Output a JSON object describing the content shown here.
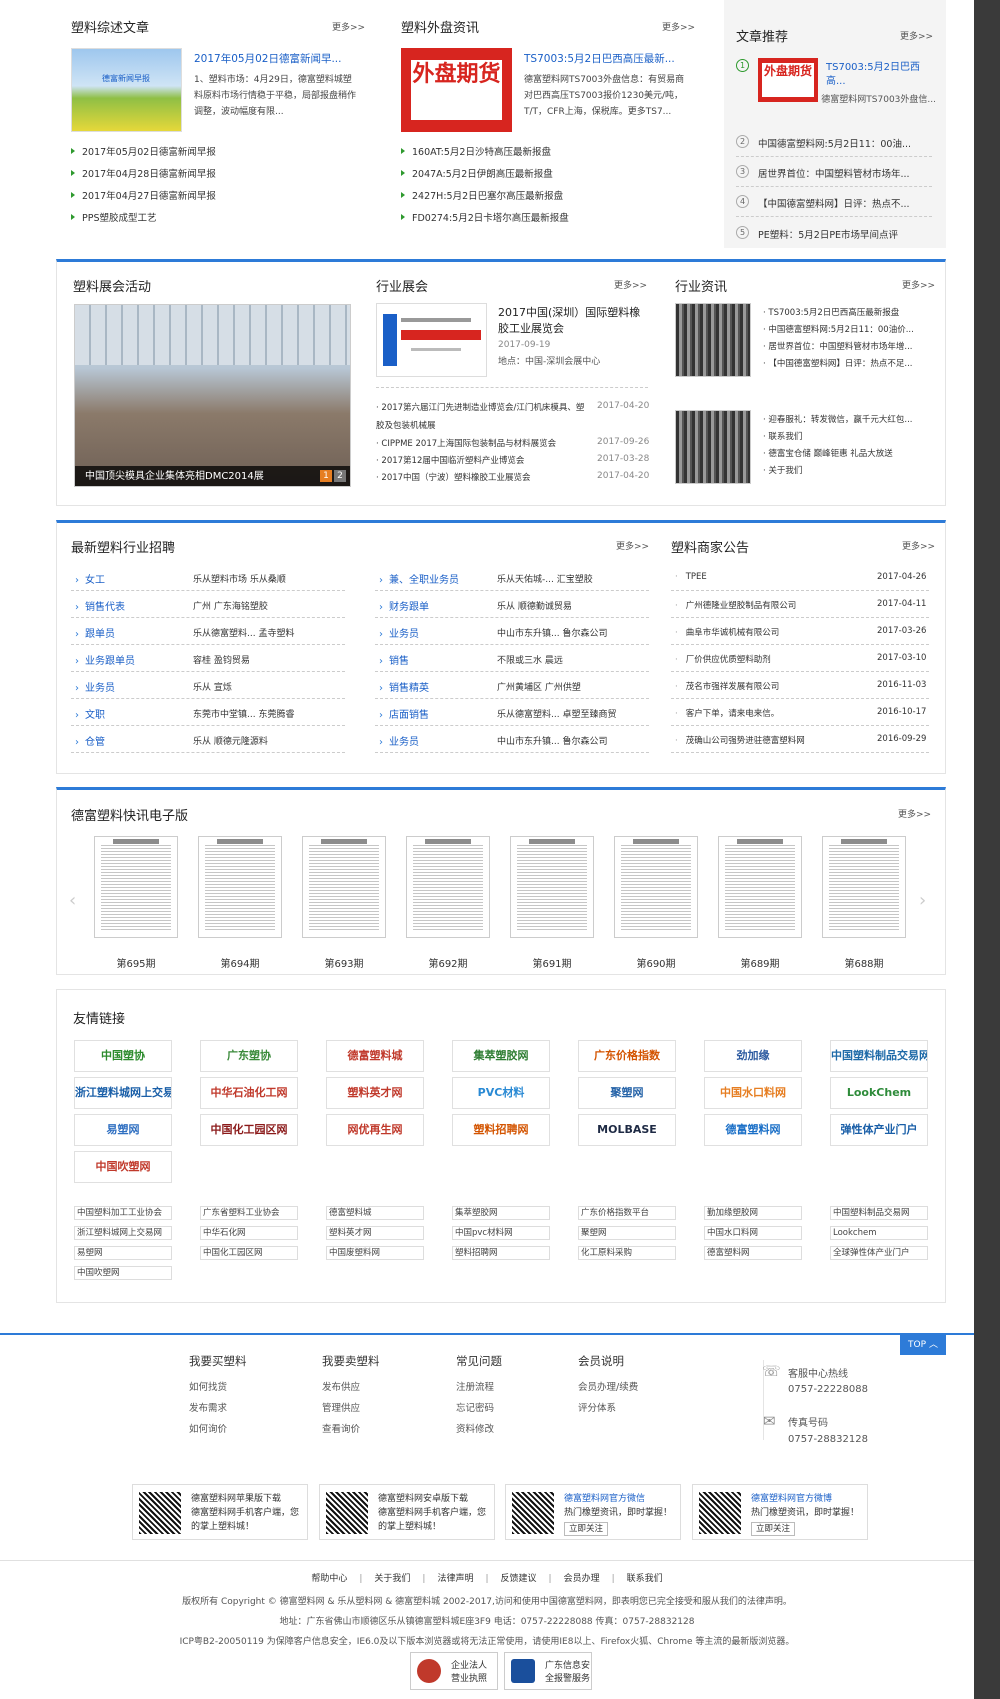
{
  "s1": {
    "left": {
      "title": "塑料综述文章",
      "more": "更多>>",
      "headline": "2017年05月02日德富新闻早...",
      "summary": "1、塑料市场：4月29日，德富塑料城塑料原料市场行情稳于平稳，局部报盘稍作调整，波动幅度有限...",
      "img_text": "德富新闻早报",
      "list": [
        "2017年05月02日德富新闻早报",
        "2017年04月28日德富新闻早报",
        "2017年04月27日德富新闻早报",
        "PPS塑胶成型工艺"
      ]
    },
    "mid": {
      "title": "塑料外盘资讯",
      "more": "更多>>",
      "headline": "TS7003:5月2日巴西高压最新...",
      "summary": "德富塑料网TS7003外盘信息：有贸易商对巴西高压TS7003报价1230美元/吨，T/T，CFR上海，保税库。更多TS7...",
      "img_text": "外盘期货",
      "list": [
        "160AT:5月2日沙特高压最新报盘",
        "2047A:5月2日伊朗高压最新报盘",
        "2427H:5月2日巴塞尔高压最新报盘",
        "FD0274:5月2日卡塔尔高压最新报盘"
      ]
    },
    "right": {
      "title": "文章推荐",
      "more": "更多>>",
      "top_link": "TS7003:5月2日巴西高...",
      "top_sub": "德富塑料网TS7003外盘信...",
      "img_text": "外盘期货",
      "items": [
        "中国德富塑料网:5月2日11：00油...",
        "居世界首位：中国塑料管材市场年...",
        "【中国德富塑料网】日评：热点不...",
        "PE塑料：5月2日PE市场早间点评"
      ],
      "nums": [
        "1",
        "2",
        "3",
        "4",
        "5"
      ]
    }
  },
  "s2": {
    "expo": {
      "title": "塑料展会活动",
      "caption": "中国顶尖模具企业集体亮相DMC2014展",
      "pages": [
        "1",
        "2"
      ]
    },
    "fair": {
      "title": "行业展会",
      "more": "更多>>",
      "feat_title": "2017中国(深圳）国际塑料橡胶工业展览会",
      "feat_date": "2017-09-19",
      "feat_loc": "地点：中国-深圳会展中心",
      "list": [
        {
          "t": "2017第六届江门先进制造业博览会/江门机床模具、塑胶及包装机械展",
          "d": "2017-04-20"
        },
        {
          "t": "CIPPME 2017上海国际包装制品与材料展览会",
          "d": "2017-09-26"
        },
        {
          "t": "2017第12届中国临沂塑料产业博览会",
          "d": "2017-03-28"
        },
        {
          "t": "2017中国（宁波）塑料橡胶工业展览会",
          "d": "2017-04-20"
        }
      ]
    },
    "news": {
      "title": "行业资讯",
      "more": "更多>>",
      "g1": [
        "TS7003:5月2日巴西高压最新报盘",
        "中国德富塑料网:5月2日11：00油价...",
        "居世界首位：中国塑料管材市场年增...",
        "【中国德富塑料网】日评：热点不足..."
      ],
      "g2": [
        "迎春服礼：转发微信，赢千元大红包...",
        "联系我们",
        "德富宝仓储 巅峰钜惠 礼品大放送",
        "关于我们"
      ]
    }
  },
  "s3": {
    "jobs": {
      "title": "最新塑料行业招聘",
      "more": "更多>>",
      "c1": [
        {
          "p": "女工",
          "c": "乐从塑料市场 乐从桑顺"
        },
        {
          "p": "销售代表",
          "c": "广州 广东海铭塑胶"
        },
        {
          "p": "跟单员",
          "c": "乐从德富塑料... 孟寺塑料"
        },
        {
          "p": "业务跟单员",
          "c": "容桂 盈钧贸易"
        },
        {
          "p": "业务员",
          "c": "乐从 宣烁"
        },
        {
          "p": "文职",
          "c": "东莞市中堂镇... 东莞腾睿"
        },
        {
          "p": "仓管",
          "c": "乐从 顺德元隆源料"
        }
      ],
      "c2": [
        {
          "p": "兼、全职业务员",
          "c": "乐从天佑城-... 汇宝塑胶"
        },
        {
          "p": "财务跟单",
          "c": "乐从 顺德勤诚贸易"
        },
        {
          "p": "业务员",
          "c": "中山市东升镇... 鲁尔森公司"
        },
        {
          "p": "销售",
          "c": "不限或三水 晨远"
        },
        {
          "p": "销售精英",
          "c": "广州黄埔区 广州供塑"
        },
        {
          "p": "店面销售",
          "c": "乐从德富塑料... 卓塑至臻商贸"
        },
        {
          "p": "业务员",
          "c": "中山市东升镇... 鲁尔森公司"
        }
      ]
    },
    "notice": {
      "title": "塑料商家公告",
      "more": "更多>>",
      "list": [
        {
          "t": "TPEE",
          "d": "2017-04-26"
        },
        {
          "t": "广州德隆业塑胶制品有限公司",
          "d": "2017-04-11"
        },
        {
          "t": "曲阜市华诚机械有限公司",
          "d": "2017-03-26"
        },
        {
          "t": "厂价供应优质塑料助剂",
          "d": "2017-03-10"
        },
        {
          "t": "茂名市强祥发展有限公司",
          "d": "2016-11-03"
        },
        {
          "t": "客户下单，请来电来信。",
          "d": "2016-10-17"
        },
        {
          "t": "茂确山公司强势进驻德富塑料网",
          "d": "2016-09-29"
        }
      ]
    }
  },
  "s4": {
    "title": "德富塑料快讯电子版",
    "more": "更多>>",
    "issues": [
      "第695期",
      "第694期",
      "第693期",
      "第692期",
      "第691期",
      "第690期",
      "第689期",
      "第688期"
    ]
  },
  "s5": {
    "title": "友情链接",
    "logos": [
      {
        "t": "中国塑协",
        "c": "#2c8b2c"
      },
      {
        "t": "广东塑协",
        "c": "#3a8a3a"
      },
      {
        "t": "德富塑料城",
        "c": "#c0392b"
      },
      {
        "t": "集萃塑胶网",
        "c": "#2e7d32"
      },
      {
        "t": "广东价格指数",
        "c": "#d35400"
      },
      {
        "t": "劲加缘",
        "c": "#2c5aa0"
      },
      {
        "t": "中国塑料制品交易网",
        "c": "#1e6aa8"
      },
      {
        "t": "浙江塑料城网上交易市场",
        "c": "#1a5fa8"
      },
      {
        "t": "中华石油化工网",
        "c": "#c0392b"
      },
      {
        "t": "塑料英才网",
        "c": "#c0392b"
      },
      {
        "t": "PVC材料",
        "c": "#2a8ad4"
      },
      {
        "t": "聚塑网",
        "c": "#2563a8"
      },
      {
        "t": "中国水口料网",
        "c": "#e67e22"
      },
      {
        "t": "LookChem",
        "c": "#2e8b3a"
      },
      {
        "t": "易塑网",
        "c": "#2f6fc1"
      },
      {
        "t": "中国化工园区网",
        "c": "#8b1a1a"
      },
      {
        "t": "网优再生网",
        "c": "#c0392b"
      },
      {
        "t": "塑料招聘网",
        "c": "#d35400"
      },
      {
        "t": "MOLBASE",
        "c": "#1e2a44"
      },
      {
        "t": "德富塑料网",
        "c": "#1a6fc7"
      },
      {
        "t": "弹性体产业门户",
        "c": "#1a5fa8"
      },
      {
        "t": "中国吹塑网",
        "c": "#c0392b"
      }
    ],
    "texts": [
      "中国塑料加工工业协会",
      "广东省塑料工业协会",
      "德富塑料城",
      "集萃塑胶网",
      "广东价格指数平台",
      "勤加缘塑胶网",
      "中国塑料制品交易网",
      "浙江塑料城网上交易网",
      "中华石化网",
      "塑料英才网",
      "中国pvc材料网",
      "聚塑网",
      "中国水口料网",
      "Lookchem",
      "易塑网",
      "中国化工园区网",
      "中国废塑料网",
      "塑料招聘网",
      "化工原料采购",
      "德富塑料网",
      "全球弹性体产业门户",
      "中国吹塑网"
    ]
  },
  "footer": {
    "top": "TOP",
    "cols": [
      {
        "h": "我要买塑料",
        "items": [
          "如何找货",
          "发布需求",
          "如何询价"
        ]
      },
      {
        "h": "我要卖塑料",
        "items": [
          "发布供应",
          "管理供应",
          "查看询价"
        ]
      },
      {
        "h": "常见问题",
        "items": [
          "注册流程",
          "忘记密码",
          "资料修改"
        ]
      },
      {
        "h": "会员说明",
        "items": [
          "会员办理/续费",
          "评分体系"
        ]
      }
    ],
    "hotline_label": "客服中心热线",
    "hotline": "0757-22228088",
    "fax_label": "传真号码",
    "fax": "0757-28832128",
    "qrs": [
      {
        "a": "德富塑料网苹果版下载",
        "b": "德富塑料网手机客户端，您的掌上塑料城！"
      },
      {
        "a": "德富塑料网安卓版下载",
        "b": "德富塑料网手机客户端，您的掌上塑料城！"
      },
      {
        "a": "德富塑料网官方微信",
        "b": "热门橡塑资讯，即时掌握！",
        "btn": "立即关注"
      },
      {
        "a": "德富塑料网官方微博",
        "b": "热门橡塑资讯，即时掌握！",
        "btn": "立即关注"
      }
    ],
    "links": [
      "帮助中心",
      "关于我们",
      "法律声明",
      "反馈建议",
      "会员办理",
      "联系我们"
    ],
    "copy1": "版权所有 Copyright © 德富塑料网 & 乐从塑料网 & 德富塑料城 2002-2017,访问和使用中国德富塑料网，即表明您已完全接受和服从我们的法律声明。",
    "copy2": "地址：广东省佛山市顺德区乐从镇德富塑料城E座3F9 电话：0757-22228088 传真：0757-28832128",
    "copy3": "ICP粤B2-20050119 为保障客户信息安全，IE6.0及以下版本浏览器或将无法正常使用，请使用IE8以上、Firefox火狐、Chrome 等主流的最新版浏览器。",
    "badge1": [
      "企业法人",
      "营业执照"
    ],
    "badge2": [
      "广东信息安",
      "全报警服务"
    ]
  },
  "colors": {
    "accent": "#2d7bd8",
    "link": "#1a5fc7",
    "bullet": "#2e9a2e"
  }
}
